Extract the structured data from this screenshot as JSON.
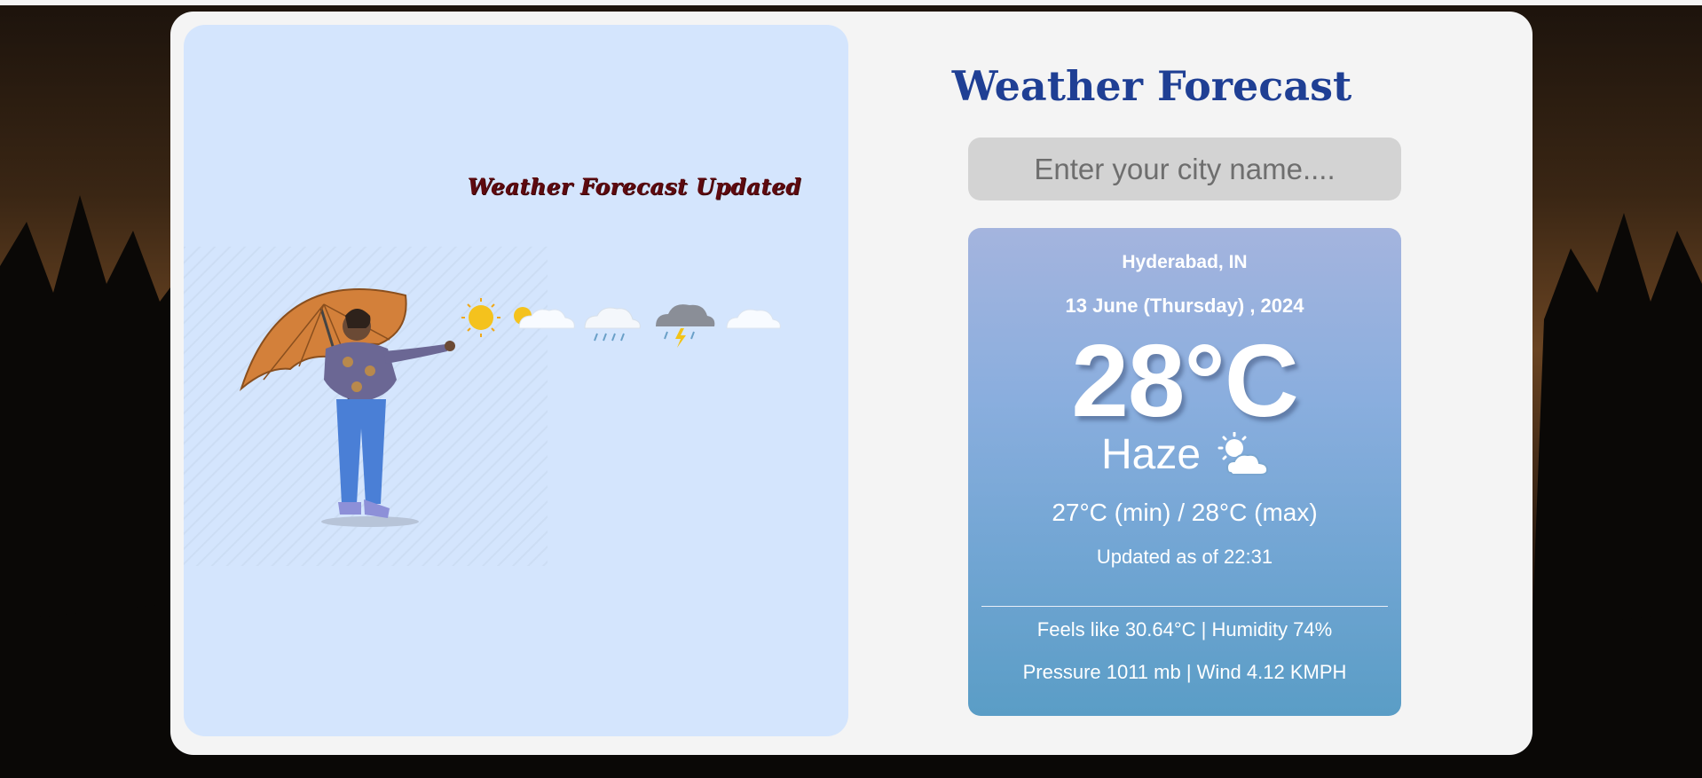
{
  "left_panel": {
    "title": "Weather Forecast Updated",
    "weather_icons": [
      "sun-icon",
      "sun-behind-cloud-icon",
      "rain-cloud-icon",
      "thunderstorm-icon",
      "cloud-icon"
    ]
  },
  "header": {
    "title": "Weather Forecast"
  },
  "search": {
    "placeholder": "Enter your city name...."
  },
  "weather": {
    "city": "Hyderabad, IN",
    "date": "13 June (Thursday) , 2024",
    "temperature": "28°C",
    "condition": "Haze",
    "condition_icon": "haze-cloud-icon",
    "min_max": "27°C (min) / 28°C (max)",
    "updated": "Updated as of 22:31",
    "feels_humidity": "Feels like 30.64°C | Humidity 74%",
    "pressure_wind": "Pressure 1011 mb | Wind 4.12 KMPH"
  },
  "colors": {
    "title_blue": "#1f3f94",
    "left_panel_bg": "#d4e5fd",
    "left_title": "#5e0a0f",
    "card_bg": "#f4f4f4",
    "search_bg": "#d3d3d3"
  }
}
